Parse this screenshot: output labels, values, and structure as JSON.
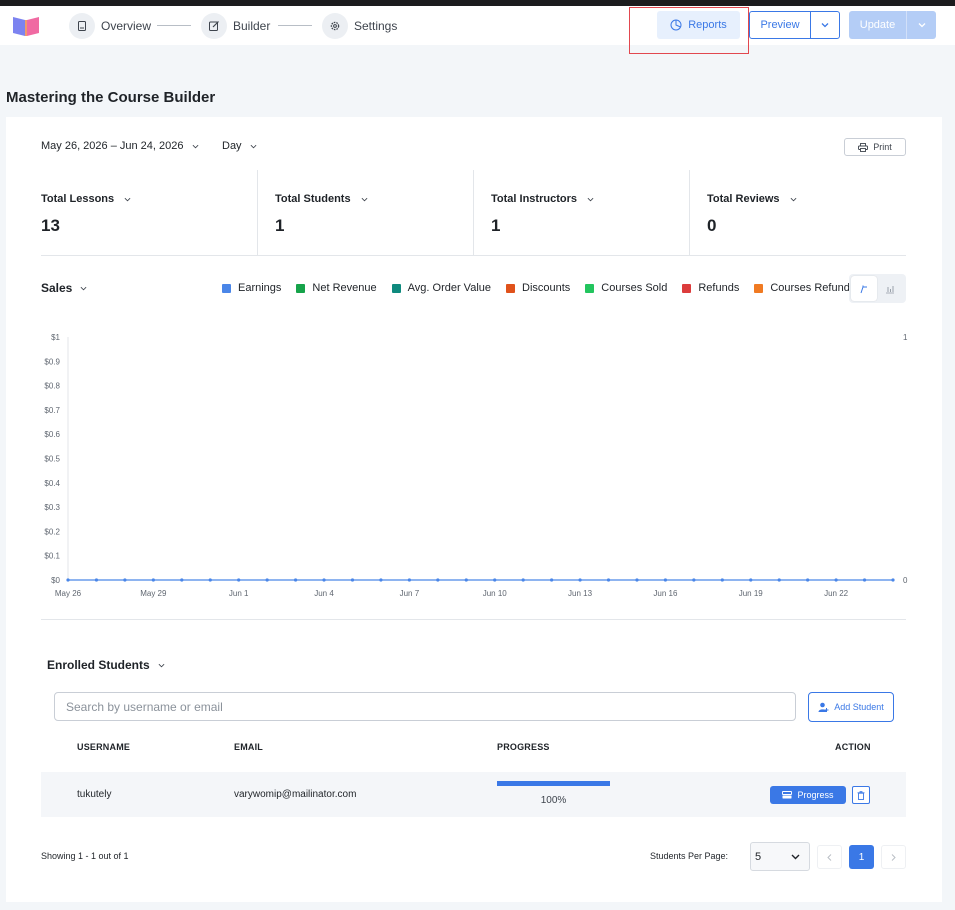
{
  "header": {
    "steps": [
      {
        "label": "Overview",
        "icon": "document-icon"
      },
      {
        "label": "Builder",
        "icon": "edit-icon"
      },
      {
        "label": "Settings",
        "icon": "gear-icon"
      }
    ],
    "reports_label": "Reports",
    "preview_label": "Preview",
    "update_label": "Update"
  },
  "page_title": "Mastering the Course Builder",
  "filters": {
    "date_range": "May 26, 2026 – Jun 24, 2026",
    "period": "Day",
    "print_label": "Print"
  },
  "stats": [
    {
      "label": "Total Lessons",
      "value": "13"
    },
    {
      "label": "Total Students",
      "value": "1"
    },
    {
      "label": "Total Instructors",
      "value": "1"
    },
    {
      "label": "Total Reviews",
      "value": "0"
    }
  ],
  "sales": {
    "label": "Sales",
    "legend": [
      {
        "name": "Earnings",
        "color": "#4a86e8"
      },
      {
        "name": "Net Revenue",
        "color": "#16a34a"
      },
      {
        "name": "Avg. Order Value",
        "color": "#0f8a7e"
      },
      {
        "name": "Discounts",
        "color": "#e0521b"
      },
      {
        "name": "Courses Sold",
        "color": "#22c55e"
      },
      {
        "name": "Refunds",
        "color": "#dc3c3c"
      },
      {
        "name": "Courses Refunded",
        "color": "#f07a22"
      }
    ]
  },
  "chart_data": {
    "type": "line",
    "title": "",
    "x": [
      "May 26",
      "May 27",
      "May 28",
      "May 29",
      "May 30",
      "May 31",
      "Jun 1",
      "Jun 2",
      "Jun 3",
      "Jun 4",
      "Jun 5",
      "Jun 6",
      "Jun 7",
      "Jun 8",
      "Jun 9",
      "Jun 10",
      "Jun 11",
      "Jun 12",
      "Jun 13",
      "Jun 14",
      "Jun 15",
      "Jun 16",
      "Jun 17",
      "Jun 18",
      "Jun 19",
      "Jun 20",
      "Jun 21",
      "Jun 22",
      "Jun 23",
      "Jun 24"
    ],
    "x_tick_labels": [
      "May 26",
      "May 29",
      "Jun 1",
      "Jun 4",
      "Jun 7",
      "Jun 10",
      "Jun 13",
      "Jun 16",
      "Jun 19",
      "Jun 22"
    ],
    "y_tick_labels": [
      "$0",
      "$0.1",
      "$0.2",
      "$0.3",
      "$0.4",
      "$0.5",
      "$0.6",
      "$0.7",
      "$0.8",
      "$0.9",
      "$1"
    ],
    "y2_tick_labels": [
      "0",
      "1"
    ],
    "ylim": [
      0,
      1
    ],
    "y2lim": [
      0,
      1
    ],
    "grid": false,
    "series": [
      {
        "name": "Earnings",
        "values": [
          0,
          0,
          0,
          0,
          0,
          0,
          0,
          0,
          0,
          0,
          0,
          0,
          0,
          0,
          0,
          0,
          0,
          0,
          0,
          0,
          0,
          0,
          0,
          0,
          0,
          0,
          0,
          0,
          0,
          0
        ]
      }
    ]
  },
  "enrolled": {
    "label": "Enrolled Students",
    "search_placeholder": "Search by username or email",
    "add_student_label": "Add Student",
    "columns": [
      "USERNAME",
      "EMAIL",
      "PROGRESS",
      "ACTION"
    ],
    "rows": [
      {
        "username": "tukutely",
        "email": "varywomip@mailinator.com",
        "progress": 100,
        "progress_text": "100%",
        "action_label": "Progress"
      }
    ],
    "showing_text": "Showing 1 - 1 out of 1",
    "per_page_label": "Students Per Page:",
    "per_page_value": "5",
    "current_page": "1"
  }
}
